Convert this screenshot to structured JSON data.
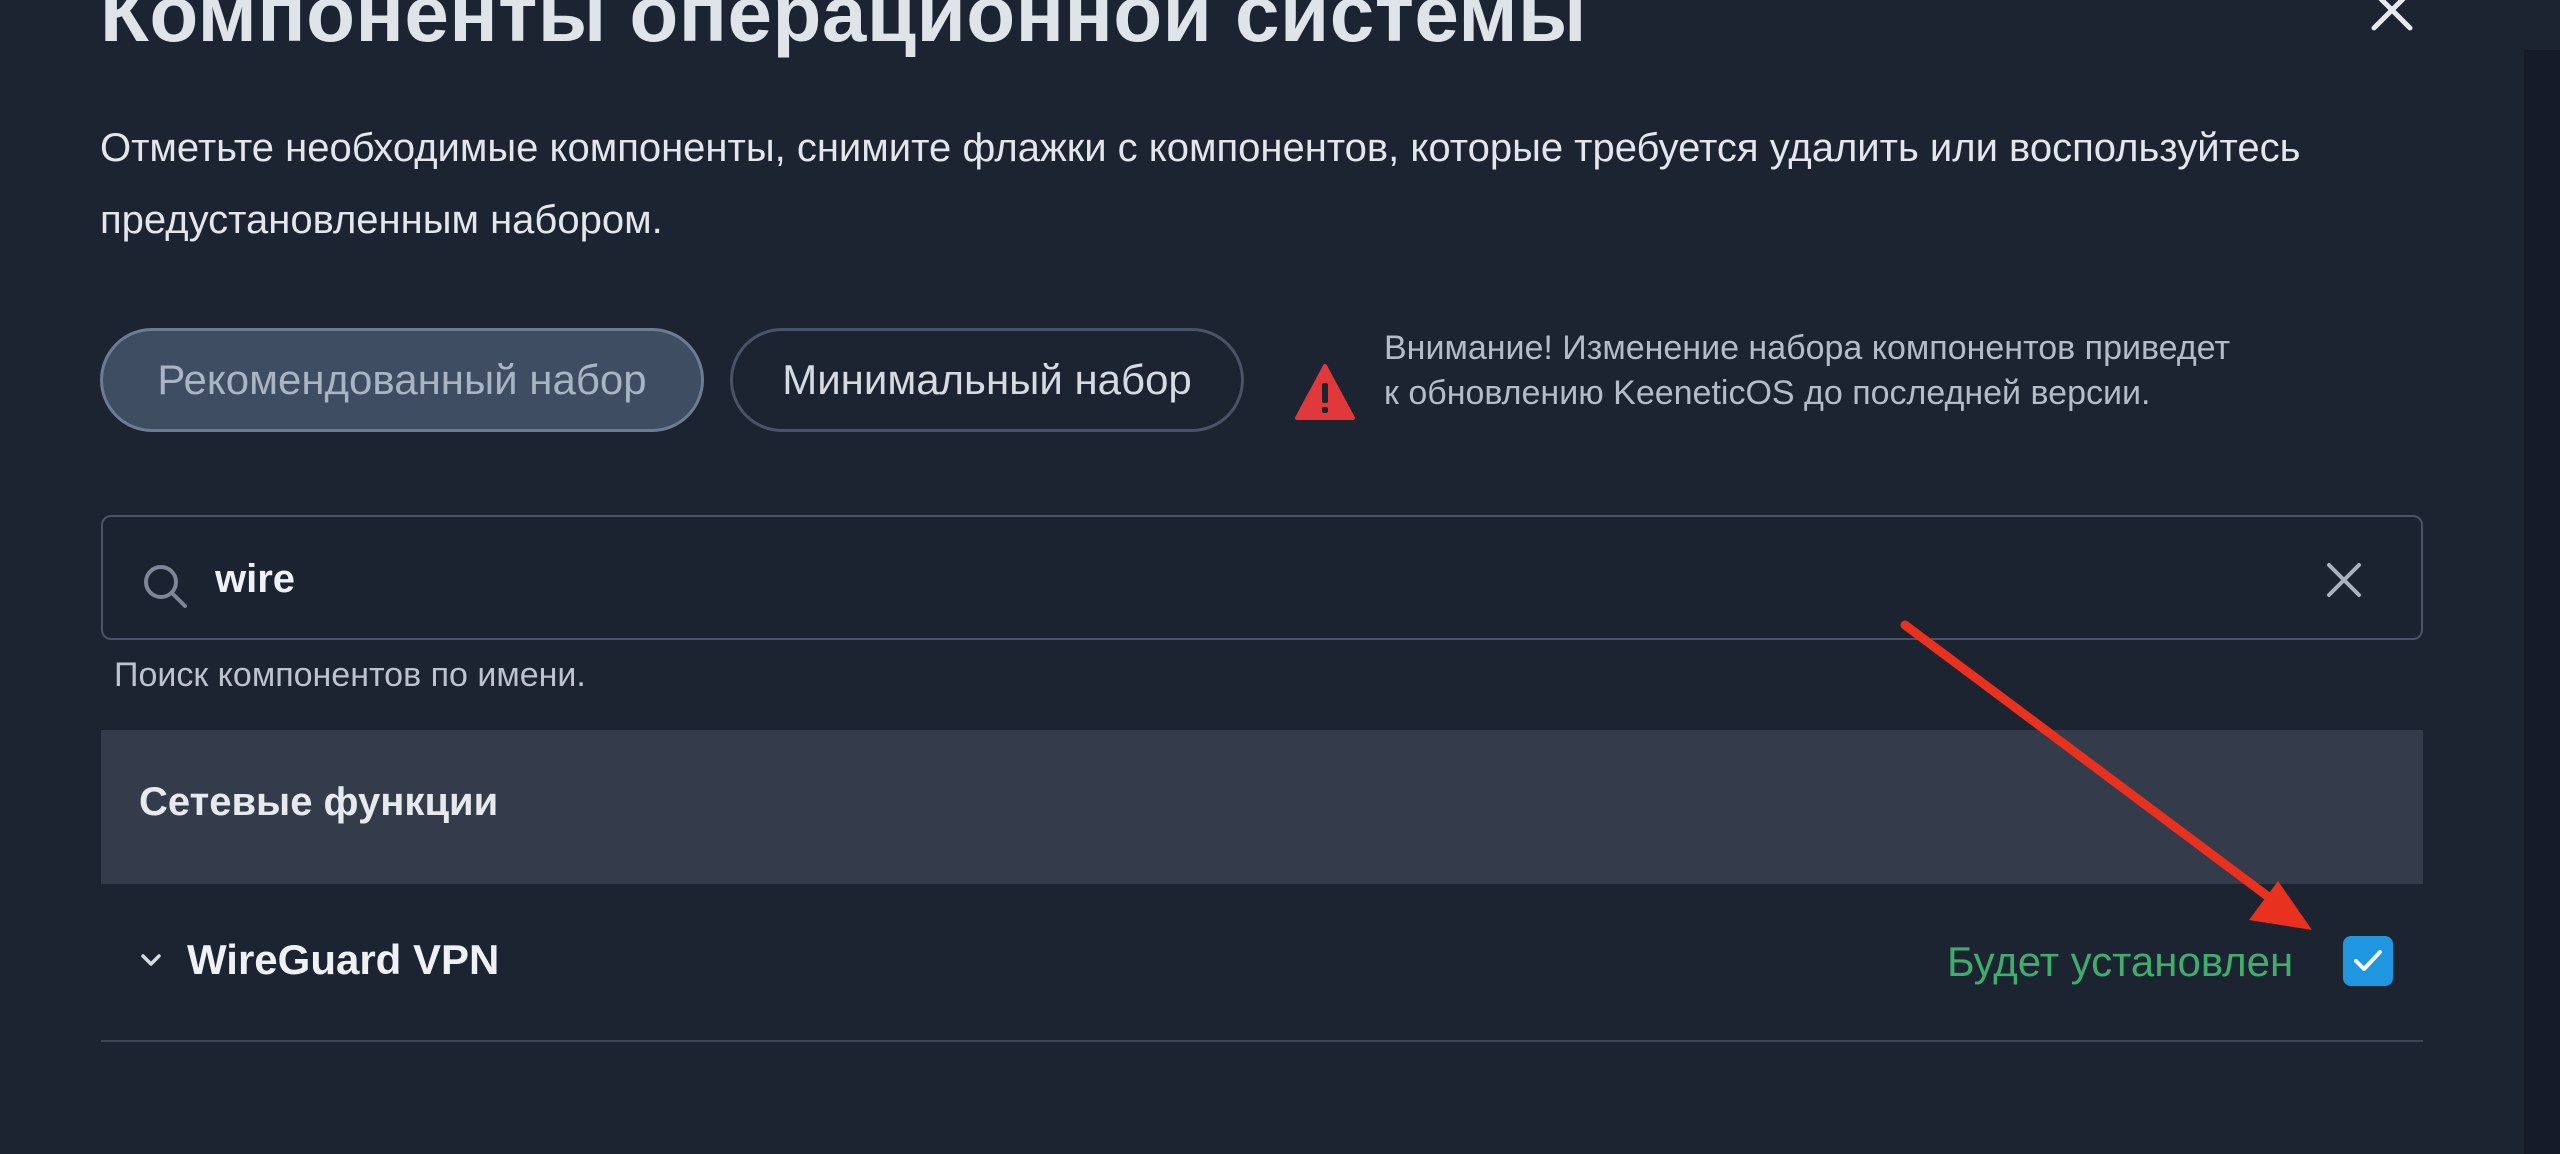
{
  "page": {
    "title": "Компоненты операционной системы",
    "description": "Отметьте необходимые компоненты, снимите флажки с компонентов, которые требуется удалить или воспользуйтесь предустановленным набором."
  },
  "presets": {
    "recommended_label": "Рекомендованный набор",
    "minimal_label": "Минимальный набор",
    "active": "recommended"
  },
  "warning": {
    "text": "Внимание! Изменение набора компонентов приведет к обновлению KeeneticOS до последней версии.",
    "icon": "warning-triangle-icon",
    "color": "#e0383b"
  },
  "search": {
    "value": "wire",
    "helper": "Поиск компонентов по имени."
  },
  "section": {
    "title": "Сетевые функции"
  },
  "components": [
    {
      "name": "WireGuard VPN",
      "status": "Будет установлен",
      "checked": true
    }
  ],
  "colors": {
    "background": "#1c2331",
    "status_green": "#3fae6c",
    "checkbox_blue": "#1f97e0",
    "annotation_red": "#e8311f"
  }
}
